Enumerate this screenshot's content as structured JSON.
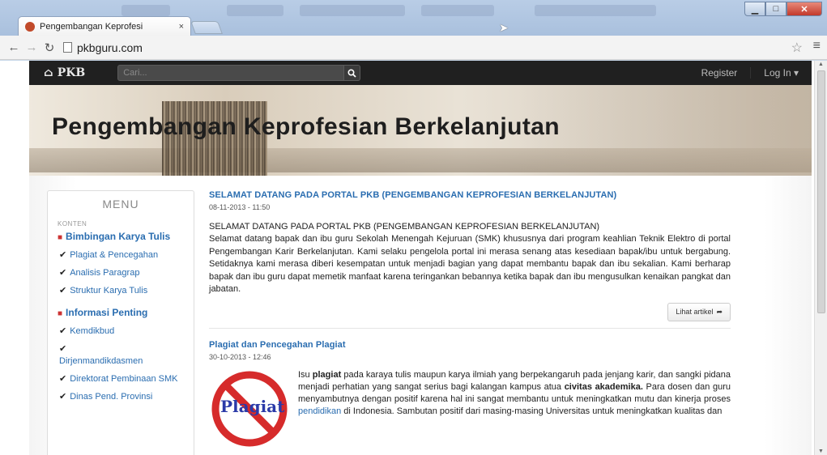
{
  "browser": {
    "tab_title": "Pengembangan Keprofesi",
    "tab_close": "×",
    "url": "pkbguru.com",
    "back_icon": "back-arrow-icon",
    "forward_icon": "forward-arrow-icon",
    "reload_icon": "reload-icon",
    "window_buttons": {
      "minimize": "▁",
      "maximize": "□",
      "close": "✕"
    }
  },
  "site_nav": {
    "brand": "PKB",
    "search_placeholder": "Cari...",
    "register": "Register",
    "login": "Log In ▾"
  },
  "banner": {
    "title": "Pengembangan Keprofesian Berkelanjutan"
  },
  "sidebar": {
    "title": "MENU",
    "section": "KONTEN",
    "group1": "Bimbingan Karya Tulis",
    "group1_items": [
      "Plagiat & Pencegahan",
      "Analisis Paragrap",
      "Struktur Karya Tulis"
    ],
    "group2": "Informasi Penting",
    "group2_items": [
      "Kemdikbud",
      "Dirjenmandikdasmen",
      "Direktorat Pembinaan SMK",
      "Dinas Pend. Provinsi"
    ]
  },
  "posts": [
    {
      "title": "SELAMAT DATANG PADA PORTAL PKB (PENGEMBANGAN KEPROFESIAN BERKELANJUTAN)",
      "date": "08-11-2013 - 11:50",
      "heading": "SELAMAT DATANG PADA PORTAL PKB (PENGEMBANGAN KEPROFESIAN BERKELANJUTAN)",
      "text": "Selamat datang bapak dan ibu guru Sekolah Menengah Kejuruan (SMK) khususnya dari program keahlian Teknik Elektro di portal Pengembangan Karir Berkelanjutan. Kami selaku pengelola portal ini merasa senang atas kesediaan bapak/ibu untuk bergabung. Setidaknya kami merasa diberi kesempatan untuk menjadi bagian yang dapat membantu bapak dan ibu sekalian. Kami berharap bapak dan ibu guru dapat memetik manfaat karena teringankan bebannya ketika bapak dan ibu mengusulkan kenaikan pangkat dan jabatan.",
      "read_more": "Lihat artikel"
    },
    {
      "title": "Plagiat dan Pencegahan Plagiat",
      "date": "30-10-2013 - 12:46",
      "image_text": "Plagiat",
      "text_1": "Isu ",
      "text_b1": "plagiat",
      "text_2": " pada karaya tulis maupun karya ilmiah yang berpekangaruh pada jenjang karir, dan sangki pidana menjadi perhatian yang sangat serius bagi kalangan kampus atua ",
      "text_b2": "civitas akademika.",
      "text_3": " Para dosen dan guru menyambutnya dengan positif karena hal ini sangat membantu untuk meningkatkan mutu dan kinerja proses ",
      "text_link": "pendidikan",
      "text_4": " di Indonesia. Sambutan positif dari masing-masing Universitas untuk meningkatkan kualitas dan"
    }
  ],
  "colors": {
    "link": "#2a6db0",
    "nav_bg": "#202020",
    "bookmark": "#cc3333"
  }
}
